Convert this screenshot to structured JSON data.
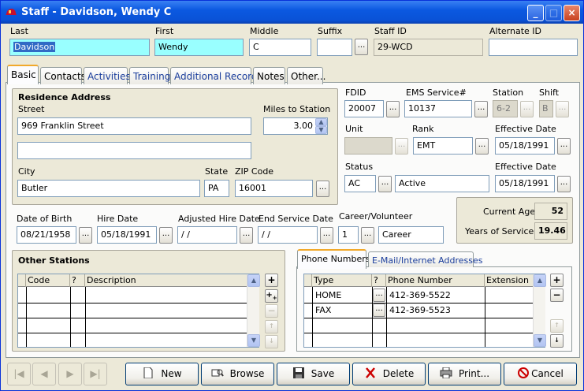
{
  "window": {
    "title": "Staff  - Davidson, Wendy C"
  },
  "header": {
    "last_label": "Last",
    "last_value": "Davidson",
    "first_label": "First",
    "first_value": "Wendy",
    "middle_label": "Middle",
    "middle_value": "C",
    "suffix_label": "Suffix",
    "suffix_value": "",
    "staffid_label": "Staff ID",
    "staffid_value": "29-WCD",
    "altid_label": "Alternate ID",
    "altid_value": ""
  },
  "tabs": [
    {
      "label": "Basic"
    },
    {
      "label": "Contacts"
    },
    {
      "label": "Activities"
    },
    {
      "label": "Training"
    },
    {
      "label": "Additional Records"
    },
    {
      "label": "Notes"
    },
    {
      "label": "Other..."
    }
  ],
  "residence": {
    "title": "Residence Address",
    "street_label": "Street",
    "street1": "969 Franklin Street",
    "street2": "",
    "miles_label": "Miles to Station",
    "miles_value": "3.00",
    "city_label": "City",
    "city_value": "Butler",
    "state_label": "State",
    "state_value": "PA",
    "zip_label": "ZIP Code",
    "zip_value": "16001"
  },
  "assignment": {
    "fdid_label": "FDID",
    "fdid_value": "20007",
    "ems_label": "EMS Service#",
    "ems_value": "10137",
    "station_label": "Station",
    "station_value": "6-2",
    "shift_label": "Shift",
    "shift_value": "B",
    "unit_label": "Unit",
    "unit_value": "",
    "rank_label": "Rank",
    "rank_value": "EMT",
    "eff1_label": "Effective Date",
    "eff1_value": "05/18/1991",
    "status_label": "Status",
    "status_code": "AC",
    "status_desc": "Active",
    "eff2_label": "Effective Date",
    "eff2_value": "05/18/1991"
  },
  "dates": {
    "dob_label": "Date of Birth",
    "dob_value": "08/21/1958",
    "hire_label": "Hire Date",
    "hire_value": "05/18/1991",
    "adjhire_label": "Adjusted Hire Date",
    "adjhire_value": " / /",
    "endsvc_label": "End Service Date",
    "endsvc_value": " / /",
    "career_label": "Career/Volunteer",
    "career_code": "1",
    "career_desc": "Career"
  },
  "age": {
    "current_label": "Current Age",
    "current_value": "52",
    "years_label": "Years of Service",
    "years_value": "19.46"
  },
  "other_stations": {
    "title": "Other Stations",
    "columns": [
      "Code",
      "?",
      "Description"
    ]
  },
  "contact_tabs": [
    {
      "label": "Phone Numbers"
    },
    {
      "label": "E-Mail/Internet Addresses"
    }
  ],
  "phones": {
    "columns": [
      "Type",
      "?",
      "Phone Number",
      "Extension"
    ],
    "rows": [
      {
        "type": "HOME",
        "number": "412-369-5522",
        "ext": ""
      },
      {
        "type": "FAX",
        "number": "412-369-5523",
        "ext": ""
      }
    ]
  },
  "buttons": {
    "new": "New",
    "browse": "Browse",
    "save": "Save",
    "delete": "Delete",
    "print": "Print...",
    "cancel": "Cancel"
  },
  "dots": "...",
  "colors": {
    "titlebar": "#0a52d6",
    "highlight_field": "#99ffff",
    "selection": "#316ac5"
  }
}
